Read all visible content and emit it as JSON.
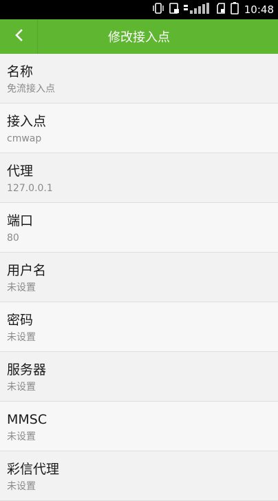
{
  "status_bar": {
    "time": "10:48",
    "icons": [
      "vibrate-icon",
      "sim-icon",
      "signal-icon",
      "sd-card-icon",
      "battery-icon"
    ]
  },
  "header": {
    "back_icon": "chevron-left-icon",
    "title": "修改接入点"
  },
  "colors": {
    "accent": "#5fb630",
    "status_bar": "#000000",
    "background": "#f7f7f7"
  },
  "items": [
    {
      "label": "名称",
      "value": "免流接入点"
    },
    {
      "label": "接入点",
      "value": "cmwap"
    },
    {
      "label": "代理",
      "value": "127.0.0.1"
    },
    {
      "label": "端口",
      "value": "80"
    },
    {
      "label": "用户名",
      "value": "未设置"
    },
    {
      "label": "密码",
      "value": "未设置"
    },
    {
      "label": "服务器",
      "value": "未设置"
    },
    {
      "label": "MMSC",
      "value": "未设置"
    },
    {
      "label": "彩信代理",
      "value": "未设置"
    }
  ]
}
